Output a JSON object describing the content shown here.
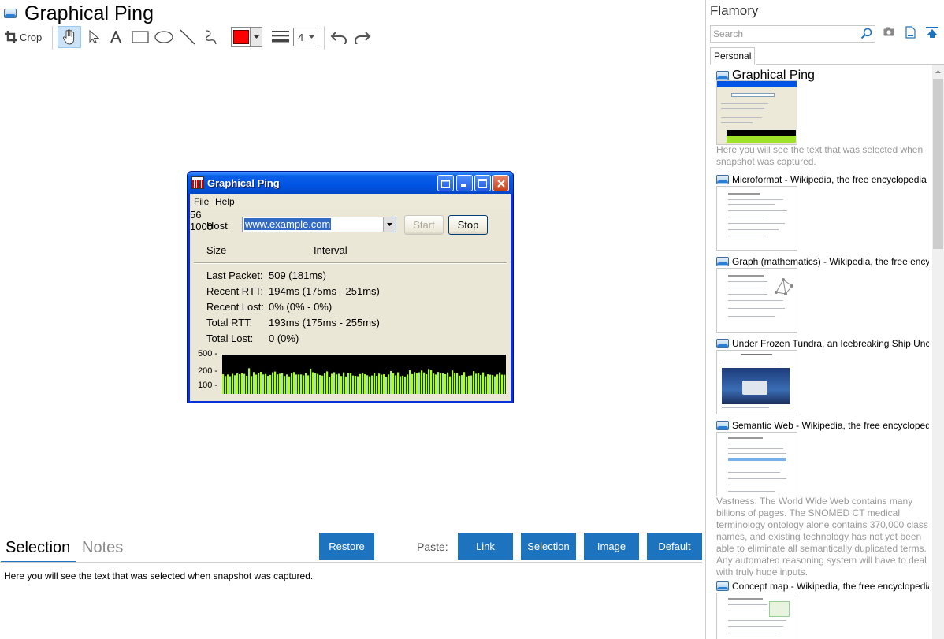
{
  "document": {
    "title": "Graphical Ping"
  },
  "toolbar": {
    "crop_label": "Crop",
    "stroke_width": "4",
    "color": "#ff0000"
  },
  "xp_window": {
    "title": "Graphical Ping",
    "menu": [
      "File",
      "Help"
    ],
    "host_label": "Host",
    "host_value": "www.example.com",
    "start_label": "Start",
    "stop_label": "Stop",
    "size_label": "Size",
    "size_value": "56",
    "interval_label": "Interval",
    "interval_value": "1000",
    "stats": [
      {
        "label": "Last Packet:",
        "value": "509 (181ms)"
      },
      {
        "label": "Recent RTT:",
        "value": "194ms (175ms - 251ms)"
      },
      {
        "label": "Recent Lost:",
        "value": "0% (0% - 0%)"
      },
      {
        "label": "Total RTT:",
        "value": "193ms (175ms - 255ms)"
      },
      {
        "label": "Total Lost:",
        "value": "0 (0%)"
      }
    ],
    "graph_axis": [
      "500 -",
      "200 -",
      "100 -"
    ],
    "bar_color": "#aaff22"
  },
  "bottom_panel": {
    "tabs": [
      "Selection",
      "Notes"
    ],
    "restore_label": "Restore",
    "paste_label": "Paste:",
    "paste_buttons": [
      "Link",
      "Selection",
      "Image",
      "Default"
    ],
    "selection_text": "Here you will see the text that was selected when snapshot was captured.",
    "accent": "#1e73be"
  },
  "sidebar": {
    "title": "Flamory",
    "search_placeholder": "Search",
    "tab": "Personal",
    "snapshots": [
      {
        "title": "Graphical Ping",
        "desc": "Here you will see the text that was selected when snapshot was captured."
      },
      {
        "title": "Microformat - Wikipedia, the free encyclopedia",
        "desc": ""
      },
      {
        "title": "Graph (mathematics) - Wikipedia, the free encyclopedia",
        "desc": ""
      },
      {
        "title": "Under Frozen Tundra, an Icebreaking Ship Uncovers a Lost World",
        "desc": ""
      },
      {
        "title": "Semantic Web - Wikipedia, the free encyclopedia",
        "desc": "Vastness: The World Wide Web contains many billions of pages. The SNOMED CT medical terminology ontology alone contains 370,000 class names, and existing technology has not yet been able to eliminate all semantically duplicated terms. Any automated reasoning system will have to deal with truly huge inputs."
      },
      {
        "title": "Concept map - Wikipedia, the free encyclopedia",
        "desc": ""
      }
    ]
  }
}
